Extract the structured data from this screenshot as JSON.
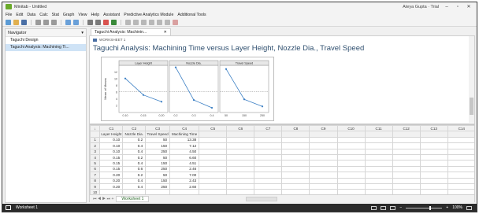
{
  "app": {
    "title": "Minitab - Untitled",
    "user": "Ateya Gupta · Trial",
    "minimize": "–",
    "maximize": "▫",
    "close": "✕"
  },
  "menu": [
    "File",
    "Edit",
    "Data",
    "Calc",
    "Stat",
    "Graph",
    "View",
    "Help",
    "Assistant",
    "Predictive Analytics Module",
    "Additional Tools"
  ],
  "navigator": {
    "title": "Navigator",
    "collapse": "▾",
    "items": [
      "Taguchi Design",
      "Taguchi Analysis: Machining Ti..."
    ]
  },
  "doc_tab": {
    "label": "Taguchi Analysis: Machinin...",
    "close": "✕"
  },
  "output": {
    "worksheet_label": "WORKSHEET 1",
    "title": "Taguchi Analysis: Machining Time versus Layer Height, Nozzle Dia., Travel Speed"
  },
  "chart_data": {
    "type": "line",
    "title": "",
    "ylabel": "Mean of Means",
    "ylim": [
      0,
      14
    ],
    "yticks": [
      2,
      4,
      6,
      8,
      10,
      12
    ],
    "grand_mean": 6.2,
    "panels": [
      {
        "name": "Layer Height",
        "categories": [
          "0.10",
          "0.15",
          "0.20"
        ],
        "values": [
          10.1,
          5.2,
          3.2
        ]
      },
      {
        "name": "Nozzle Dia.",
        "categories": [
          "0.2",
          "0.3",
          "0.4"
        ],
        "values": [
          13.4,
          3.7,
          1.4
        ]
      },
      {
        "name": "Travel Speed",
        "categories": [
          "50",
          "150",
          "250"
        ],
        "values": [
          12.9,
          3.9,
          1.8
        ]
      }
    ],
    "color": "#3b7fc4"
  },
  "sheet": {
    "col_labels": [
      "C1",
      "C2",
      "C3",
      "C4",
      "C5",
      "C6",
      "C7",
      "C8",
      "C9",
      "C10",
      "C11",
      "C12",
      "C13",
      "C14",
      "C15",
      "C16"
    ],
    "col_names": [
      "Layer Height",
      "Nozzle Dia.",
      "Travel Speed",
      "Machining Time",
      "",
      "",
      "",
      "",
      "",
      "",
      "",
      "",
      "",
      "",
      "",
      ""
    ],
    "rows": [
      [
        "0.10",
        "0.2",
        "50",
        "13.38"
      ],
      [
        "0.10",
        "0.4",
        "150",
        "7.12"
      ],
      [
        "0.10",
        "0.4",
        "250",
        "4.50"
      ],
      [
        "0.15",
        "0.2",
        "50",
        "6.60"
      ],
      [
        "0.15",
        "0.4",
        "150",
        "4.51"
      ],
      [
        "0.15",
        "0.6",
        "250",
        "2.46"
      ],
      [
        "0.20",
        "0.2",
        "50",
        "7.00"
      ],
      [
        "0.20",
        "0.4",
        "150",
        "2.43"
      ],
      [
        "0.20",
        "0.4",
        "250",
        "2.60"
      ]
    ],
    "tab_label": "Worksheet 1",
    "nav_arrows": "⏮ ◀ ▶ ⏭ +"
  },
  "status": {
    "left": "Worksheet 1",
    "zoom": "100%"
  },
  "colors": {
    "line": "#3b7fc4",
    "title": "#2f4f6f",
    "selection": "#cfe3f6"
  }
}
